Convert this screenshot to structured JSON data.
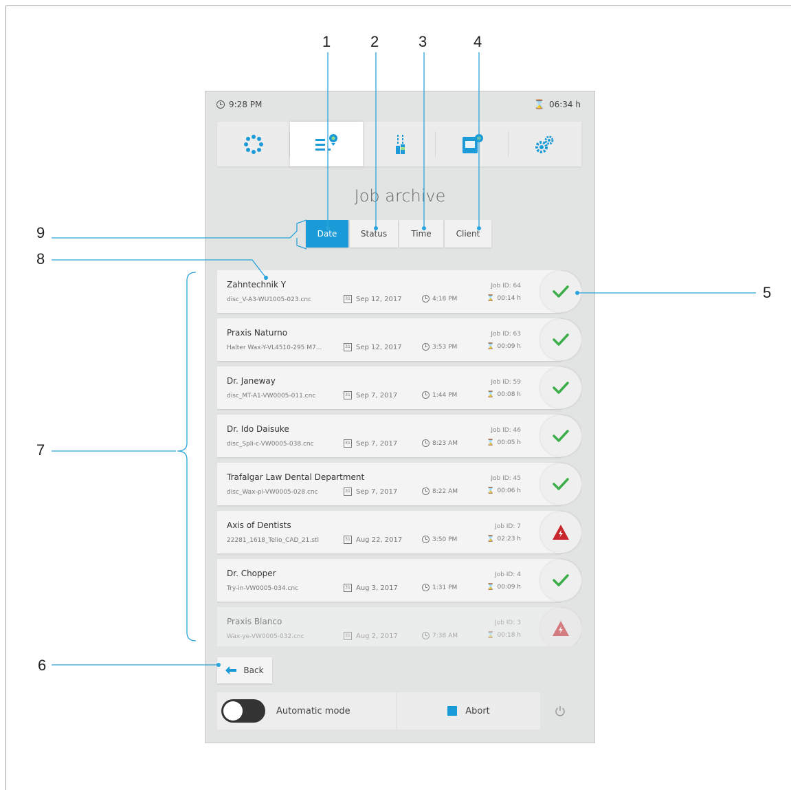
{
  "status": {
    "time": "9:28 PM",
    "duration": "06:34 h"
  },
  "nav_tabs": [
    {
      "icon": "dots-circle-icon"
    },
    {
      "icon": "job-list-icon",
      "active": true
    },
    {
      "icon": "burs-icon"
    },
    {
      "icon": "material-block-icon"
    },
    {
      "icon": "settings-gears-icon"
    }
  ],
  "page_title": "Job archive",
  "sort_buttons": [
    {
      "label": "Date",
      "active": true
    },
    {
      "label": "Status"
    },
    {
      "label": "Time"
    },
    {
      "label": "Client"
    }
  ],
  "jobs": [
    {
      "name": "Zahntechnik Y",
      "file": "disc_V-A3-WU1005-023.cnc",
      "date": "Sep 12, 2017",
      "time": "4:18 PM",
      "job_id": "Job ID: 64",
      "duration": "00:14 h",
      "status": "success"
    },
    {
      "name": "Praxis Naturno",
      "file": "Halter Wax-Y-VL4510-295 M7...",
      "date": "Sep 12, 2017",
      "time": "3:53 PM",
      "job_id": "Job ID: 63",
      "duration": "00:09 h",
      "status": "success"
    },
    {
      "name": "Dr. Janeway",
      "file": "disc_MT-A1-VW0005-011.cnc",
      "date": "Sep 7, 2017",
      "time": "1:44 PM",
      "job_id": "Job ID: 59",
      "duration": "00:08 h",
      "status": "success"
    },
    {
      "name": "Dr. Ido Daisuke",
      "file": "disc_Spli-c-VW0005-038.cnc",
      "date": "Sep 7, 2017",
      "time": "8:23 AM",
      "job_id": "Job ID: 46",
      "duration": "00:05 h",
      "status": "success"
    },
    {
      "name": "Trafalgar Law Dental Department",
      "file": "disc_Wax-pi-VW0005-028.cnc",
      "date": "Sep 7, 2017",
      "time": "8:22 AM",
      "job_id": "Job ID: 45",
      "duration": "00:06 h",
      "status": "success"
    },
    {
      "name": "Axis of Dentists",
      "file": "22281_1618_Telio_CAD_21.stl",
      "date": "Aug 22, 2017",
      "time": "3:50 PM",
      "job_id": "Job ID: 7",
      "duration": "02:23 h",
      "status": "error"
    },
    {
      "name": "Dr. Chopper",
      "file": "Try-in-VW0005-034.cnc",
      "date": "Aug 3, 2017",
      "time": "1:31 PM",
      "job_id": "Job ID: 4",
      "duration": "00:09 h",
      "status": "success"
    },
    {
      "name": "Praxis Blanco",
      "file": "Wax-ye-VW0005-032.cnc",
      "date": "Aug 2, 2017",
      "time": "7:38 AM",
      "job_id": "Job ID: 3",
      "duration": "00:18 h",
      "status": "error"
    }
  ],
  "back_label": "Back",
  "auto_mode_label": "Automatic mode",
  "abort_label": "Abort",
  "callouts": [
    "1",
    "2",
    "3",
    "4",
    "5",
    "6",
    "7",
    "8",
    "9"
  ],
  "colors": {
    "accent": "#1a9ad6",
    "success": "#3cae49",
    "error": "#c8272d",
    "panel": "#e2e3e3"
  }
}
